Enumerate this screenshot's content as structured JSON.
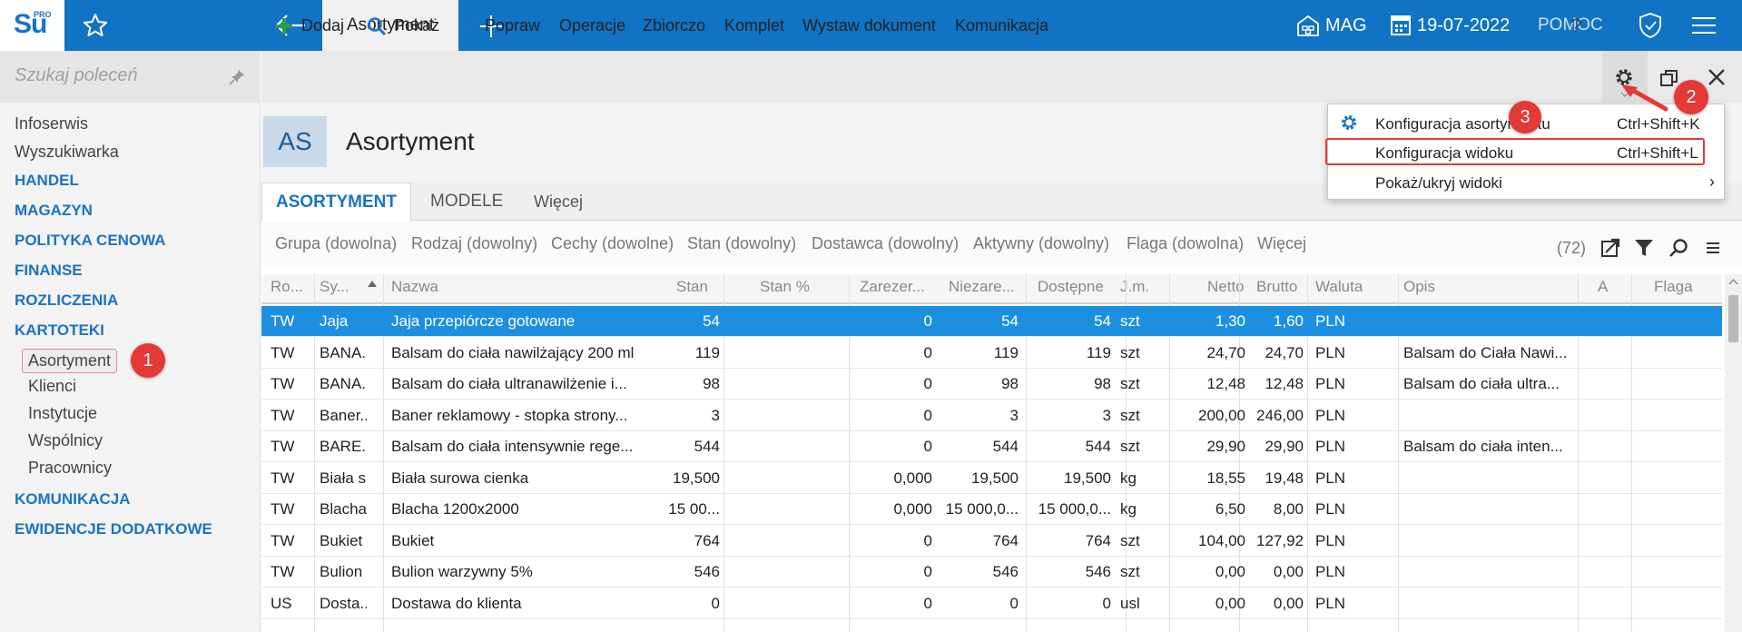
{
  "app": {
    "logo": "Su",
    "logo_superscript": "PRO"
  },
  "topbar": {
    "active_tab": "Asortyment",
    "warehouse": "MAG",
    "date": "19-07-2022",
    "help": "POMOC"
  },
  "sidebar": {
    "search_placeholder": "Szukaj poleceń",
    "items": [
      {
        "label": "Infoserwis"
      },
      {
        "label": "Wyszukiwarka"
      },
      {
        "label": "HANDEL"
      },
      {
        "label": "MAGAZYN"
      },
      {
        "label": "POLITYKA CENOWA"
      },
      {
        "label": "FINANSE"
      },
      {
        "label": "ROZLICZENIA"
      },
      {
        "label": "KARTOTEKI"
      },
      {
        "label": "Asortyment"
      },
      {
        "label": "Klienci"
      },
      {
        "label": "Instytucje"
      },
      {
        "label": "Wspólnicy"
      },
      {
        "label": "Pracownicy"
      },
      {
        "label": "KOMUNIKACJA"
      },
      {
        "label": "EWIDENCJE DODATKOWE"
      }
    ]
  },
  "toolbar": {
    "add": "Dodaj",
    "show": "Pokaż",
    "edit": "Popraw",
    "operations": "Operacje",
    "summary": "Zbiorczo",
    "set": "Komplet",
    "issue_document": "Wystaw dokument",
    "communication": "Komunikacja",
    "help_q": "?"
  },
  "header": {
    "badge": "AS",
    "title": "Asortyment"
  },
  "tabs": [
    {
      "label": "ASORTYMENT"
    },
    {
      "label": "MODELE"
    },
    {
      "label": "Więcej"
    }
  ],
  "filters": [
    {
      "label": "Grupa (dowolna)"
    },
    {
      "label": "Rodzaj (dowolny)"
    },
    {
      "label": "Cechy (dowolne)"
    },
    {
      "label": "Stan (dowolny)"
    },
    {
      "label": "Dostawca (dowolny)"
    },
    {
      "label": "Aktywny (dowolny)"
    },
    {
      "label": "Flaga (dowolna)"
    },
    {
      "label": "Więcej"
    }
  ],
  "count": "(72)",
  "table": {
    "columns": [
      "Ro...",
      "Sy...",
      "Nazwa",
      "Stan",
      "Stan %",
      "Zarezer...",
      "Niezare...",
      "Dostępne",
      "J.m.",
      "Netto",
      "Brutto",
      "Waluta",
      "Opis",
      "A",
      "Flaga"
    ],
    "rows": [
      [
        "TW",
        "Jaja",
        "Jaja przepiórcze gotowane",
        "54",
        "",
        "0",
        "54",
        "54",
        "szt",
        "1,30",
        "1,60",
        "PLN",
        ""
      ],
      [
        "TW",
        "BANA...",
        "Balsam do ciała nawilżający 200 ml",
        "119",
        "",
        "0",
        "119",
        "119",
        "szt",
        "24,70",
        "24,70",
        "PLN",
        "Balsam do Ciała Nawi..."
      ],
      [
        "TW",
        "BANA...",
        "Balsam do ciała ultranawilżenie i...",
        "98",
        "",
        "0",
        "98",
        "98",
        "szt",
        "12,48",
        "12,48",
        "PLN",
        "Balsam do ciała ultra..."
      ],
      [
        "TW",
        "Baner...",
        "Baner reklamowy - stopka strony...",
        "3",
        "",
        "0",
        "3",
        "3",
        "szt",
        "200,00",
        "246,00",
        "PLN",
        ""
      ],
      [
        "TW",
        "BARE...",
        "Balsam do ciała intensywnie rege...",
        "544",
        "",
        "0",
        "544",
        "544",
        "szt",
        "29,90",
        "29,90",
        "PLN",
        "Balsam do ciała inten..."
      ],
      [
        "TW",
        "Biała s...",
        "Biała surowa cienka",
        "19,500",
        "",
        "0,000",
        "19,500",
        "19,500",
        "kg",
        "18,55",
        "19,48",
        "PLN",
        ""
      ],
      [
        "TW",
        "Blacha...",
        "Blacha 1200x2000",
        "15 00...",
        "",
        "0,000",
        "15 000,0...",
        "15 000,0...",
        "kg",
        "6,50",
        "8,00",
        "PLN",
        ""
      ],
      [
        "TW",
        "Bukiet",
        "Bukiet",
        "764",
        "",
        "0",
        "764",
        "764",
        "szt",
        "104,00",
        "127,92",
        "PLN",
        ""
      ],
      [
        "TW",
        "Bulion",
        "Bulion warzywny 5%",
        "546",
        "",
        "0",
        "546",
        "546",
        "szt",
        "0,00",
        "0,00",
        "PLN",
        ""
      ],
      [
        "US",
        "Dosta...",
        "Dostawa do klienta",
        "0",
        "",
        "0",
        "0",
        "0",
        "usl",
        "0,00",
        "0,00",
        "PLN",
        ""
      ]
    ]
  },
  "dropdown": {
    "items": [
      {
        "label": "Konfiguracja asortymentu",
        "shortcut": "Ctrl+Shift+K"
      },
      {
        "label": "Konfiguracja widoku",
        "shortcut": "Ctrl+Shift+L"
      },
      {
        "label": "Pokaż/ukryj widoki",
        "shortcut": "›"
      }
    ]
  },
  "annotations": {
    "b1": "1",
    "b2": "2",
    "b3": "3"
  },
  "colors": {
    "brand": "#1073c4",
    "selected_row": "#1d8fe0",
    "annotation": "#e53935",
    "add_icon": "#2e9e3e"
  }
}
